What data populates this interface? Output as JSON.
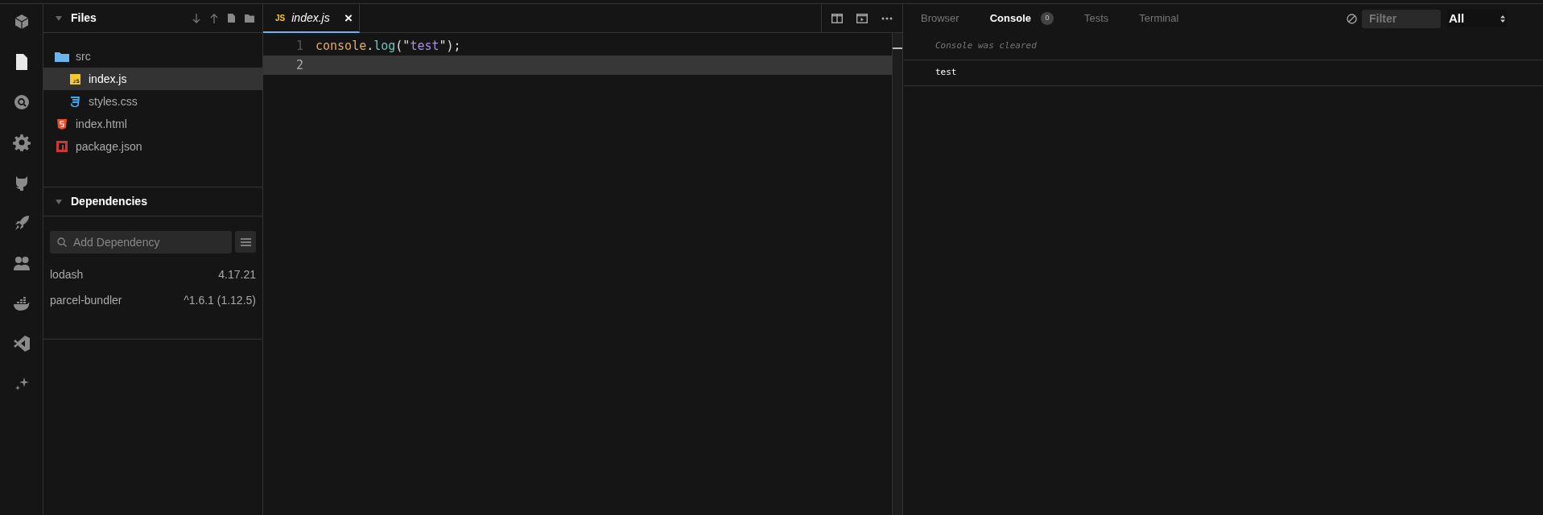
{
  "activity_bar": [
    {
      "kind": "cube",
      "selected": false
    },
    {
      "kind": "file",
      "selected": true
    },
    {
      "kind": "search",
      "selected": false
    },
    {
      "kind": "gear",
      "selected": false
    },
    {
      "kind": "github",
      "selected": false
    },
    {
      "kind": "rocket",
      "selected": false
    },
    {
      "kind": "people",
      "selected": false
    },
    {
      "kind": "docker",
      "selected": false
    },
    {
      "kind": "vscode",
      "selected": false
    },
    {
      "kind": "sparkle",
      "selected": false
    }
  ],
  "files": {
    "title": "Files",
    "items": [
      {
        "name": "src",
        "kind": "folder",
        "selected": false,
        "children": [
          {
            "name": "index.js",
            "kind": "js",
            "selected": true
          },
          {
            "name": "styles.css",
            "kind": "css",
            "selected": false
          }
        ]
      },
      {
        "name": "index.html",
        "kind": "html",
        "selected": false
      },
      {
        "name": "package.json",
        "kind": "npm",
        "selected": false
      }
    ]
  },
  "dependencies": {
    "title": "Dependencies",
    "search": {
      "placeholder": "Add Dependency"
    },
    "items": [
      {
        "name": "lodash",
        "version": "4.17.21"
      },
      {
        "name": "parcel-bundler",
        "version": "^1.6.1 (1.12.5)"
      }
    ]
  },
  "editor": {
    "tabs": [
      {
        "badge": "JS",
        "label": "index.js",
        "selected": true,
        "close": "×"
      }
    ],
    "lines": [
      {
        "number": "1",
        "tokens": [
          {
            "text": "console",
            "kind": "object"
          },
          {
            "text": ".",
            "kind": "punct"
          },
          {
            "text": "log",
            "kind": "func"
          },
          {
            "text": "(\"",
            "kind": "punct"
          },
          {
            "text": "test",
            "kind": "string"
          },
          {
            "text": "\");",
            "kind": "punct"
          }
        ],
        "current": false
      },
      {
        "number": "2",
        "current": true
      }
    ]
  },
  "preview": {
    "tabs": [
      {
        "label": "Browser",
        "selected": false
      },
      {
        "label": "Console",
        "selected": true,
        "badge": "0"
      },
      {
        "label": "Tests",
        "selected": false
      },
      {
        "label": "Terminal",
        "selected": false
      }
    ],
    "filter": {
      "placeholder": "Filter"
    },
    "level_select": "All",
    "messages": [
      {
        "text": "Console was cleared",
        "kind": "info"
      },
      {
        "text": "test",
        "kind": "log"
      }
    ]
  }
}
